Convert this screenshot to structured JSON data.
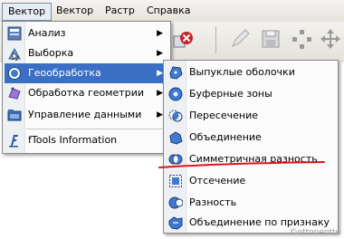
{
  "menubar": {
    "items": [
      {
        "label": "Вектор"
      },
      {
        "label": "Вектор"
      },
      {
        "label": "Растр"
      },
      {
        "label": "Справка"
      }
    ]
  },
  "menu": {
    "items": [
      {
        "label": "Анализ",
        "icon": "analysis-icon",
        "submenu": "▶"
      },
      {
        "label": "Выборка",
        "icon": "selection-icon",
        "submenu": "▶"
      },
      {
        "label": "Геообработка",
        "icon": "geoprocessing-icon",
        "submenu": "▶"
      },
      {
        "label": "Обработка геометрии",
        "icon": "geometry-icon",
        "submenu": "▶"
      },
      {
        "label": "Управление данными",
        "icon": "data-management-icon",
        "submenu": "▶"
      },
      {
        "label": "fTools Information",
        "icon": "ftools-info-icon"
      }
    ],
    "highlighted": "Геообработка"
  },
  "submenu": {
    "items": [
      {
        "label": "Выпуклые оболочки",
        "icon": "convex-hull-icon"
      },
      {
        "label": "Буферные зоны",
        "icon": "buffer-icon"
      },
      {
        "label": "Пересечение",
        "icon": "intersect-icon"
      },
      {
        "label": "Объединение",
        "icon": "union-icon"
      },
      {
        "label": "Симметричная разность",
        "icon": "symmetric-difference-icon"
      },
      {
        "label": "Отсечение",
        "icon": "clip-icon"
      },
      {
        "label": "Разность",
        "icon": "difference-icon"
      },
      {
        "label": "Объединение по признаку",
        "icon": "dissolve-icon"
      }
    ]
  },
  "watermark": "©ottoneotto",
  "colors": {
    "highlight": "#3a6fc3",
    "annotation": "#e0141c"
  }
}
